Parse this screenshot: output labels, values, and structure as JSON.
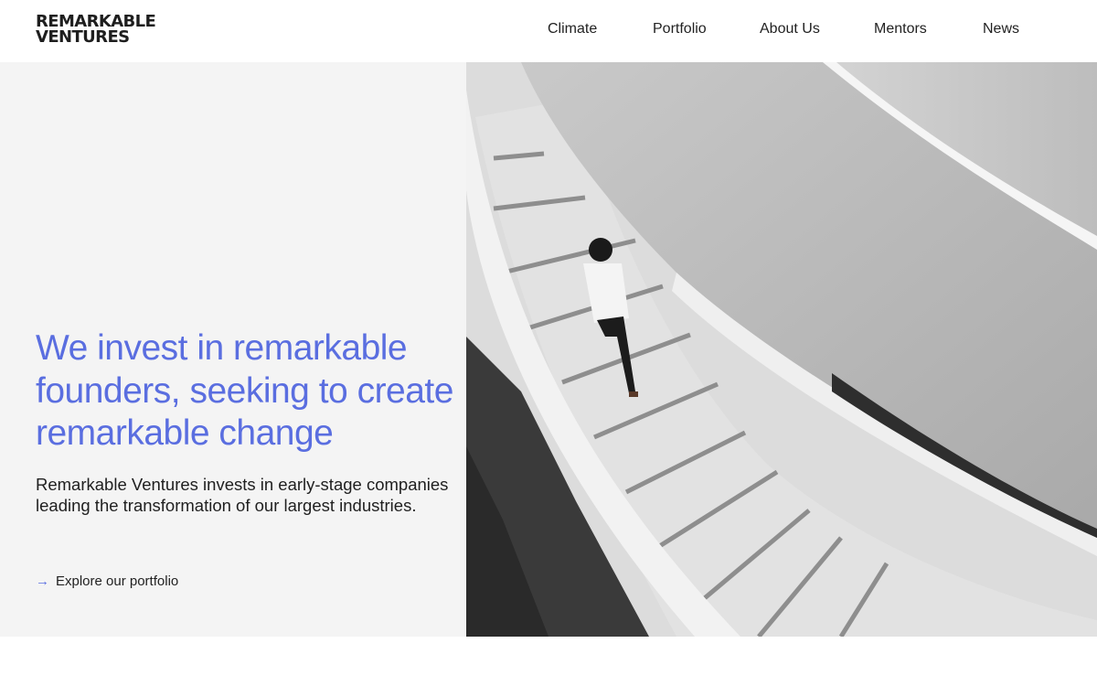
{
  "brand": {
    "line1": "REMARKABLE",
    "line2": "VENTURES"
  },
  "nav": [
    {
      "label": "Climate"
    },
    {
      "label": "Portfolio"
    },
    {
      "label": "About Us"
    },
    {
      "label": "Mentors"
    },
    {
      "label": "News"
    }
  ],
  "hero": {
    "headline": "We invest in remarkable founders, seeking to create remarkable change",
    "subtext": "Remarkable Ventures invests in early-stage companies leading the transformation of our largest industries.",
    "cta_icon": "arrow-right-icon",
    "cta_label": "Explore our portfolio",
    "image": "spiral-staircase-person-photo"
  },
  "colors": {
    "accent": "#5a6ee0",
    "panel": "#f4f4f4",
    "text": "#222222"
  }
}
